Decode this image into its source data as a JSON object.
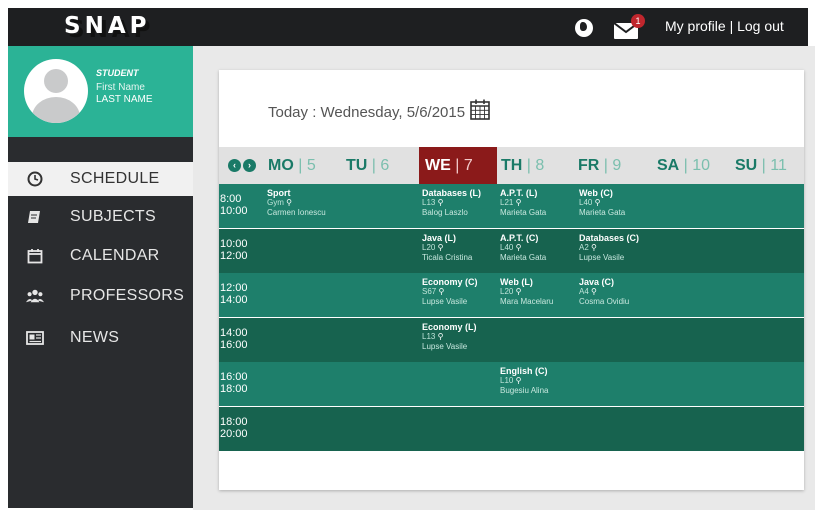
{
  "app": {
    "logo": "SNAP"
  },
  "topbar": {
    "notification_count": "1",
    "my_profile": "My profile",
    "separator": "|",
    "log_out": "Log out",
    "icons": [
      "globe-icon",
      "mail-icon"
    ]
  },
  "student": {
    "label": "STUDENT",
    "first_name": "First Name",
    "last_name": "LAST NAME"
  },
  "sidebar": {
    "items": [
      {
        "label": "SCHEDULE",
        "icon": "clock-icon",
        "active": true
      },
      {
        "label": "SUBJECTS",
        "icon": "book-icon",
        "active": false
      },
      {
        "label": "CALENDAR",
        "icon": "calendar-icon",
        "active": false
      },
      {
        "label": "PROFESSORS",
        "icon": "people-icon",
        "active": false
      },
      {
        "label": "NEWS",
        "icon": "newspaper-icon",
        "active": false
      }
    ]
  },
  "main": {
    "today_text": "Today : Wednesday, 5/6/2015"
  },
  "days": [
    {
      "name": "MO",
      "num": "5"
    },
    {
      "name": "TU",
      "num": "6"
    },
    {
      "name": "WE",
      "num": "7"
    },
    {
      "name": "TH",
      "num": "8"
    },
    {
      "name": "FR",
      "num": "9"
    },
    {
      "name": "SA",
      "num": "10"
    },
    {
      "name": "SU",
      "num": "11"
    }
  ],
  "schedule": [
    {
      "start": "8:00",
      "end": "10:00",
      "classes": [
        {
          "day": "MO",
          "subject": "Sport",
          "room": "Gym",
          "prof": "Carmen Ionescu"
        },
        {
          "day": "WE",
          "subject": "Databases (L)",
          "room": "L13",
          "prof": "Balog Laszlo"
        },
        {
          "day": "TH",
          "subject": "A.P.T. (L)",
          "room": "L21",
          "prof": "Marieta Gata"
        },
        {
          "day": "FR",
          "subject": "Web (C)",
          "room": "L40",
          "prof": "Marieta Gata"
        }
      ]
    },
    {
      "start": "10:00",
      "end": "12:00",
      "classes": [
        {
          "day": "WE",
          "subject": "Java (L)",
          "room": "L20",
          "prof": "Ticala Cristina"
        },
        {
          "day": "TH",
          "subject": "A.P.T. (C)",
          "room": "L40",
          "prof": "Marieta Gata"
        },
        {
          "day": "FR",
          "subject": "Databases (C)",
          "room": "A2",
          "prof": "Lupse Vasile"
        }
      ]
    },
    {
      "start": "12:00",
      "end": "14:00",
      "classes": [
        {
          "day": "WE",
          "subject": "Economy (C)",
          "room": "S67",
          "prof": "Lupse Vasile"
        },
        {
          "day": "TH",
          "subject": "Web (L)",
          "room": "L20",
          "prof": "Mara Macelaru"
        },
        {
          "day": "FR",
          "subject": "Java (C)",
          "room": "A4",
          "prof": "Cosma Ovidiu"
        }
      ]
    },
    {
      "start": "14:00",
      "end": "16:00",
      "classes": [
        {
          "day": "WE",
          "subject": "Economy (L)",
          "room": "L13",
          "prof": "Lupse Vasile"
        }
      ]
    },
    {
      "start": "16:00",
      "end": "18:00",
      "classes": [
        {
          "day": "TH",
          "subject": "English (C)",
          "room": "L10",
          "prof": "Bugesiu Alina"
        }
      ]
    },
    {
      "start": "18:00",
      "end": "20:00",
      "classes": []
    }
  ],
  "colors": {
    "teal_light": "#1e7f6b",
    "teal_dark": "#17634f",
    "today_col": "#8b1a1a",
    "accent": "#2bb396"
  }
}
